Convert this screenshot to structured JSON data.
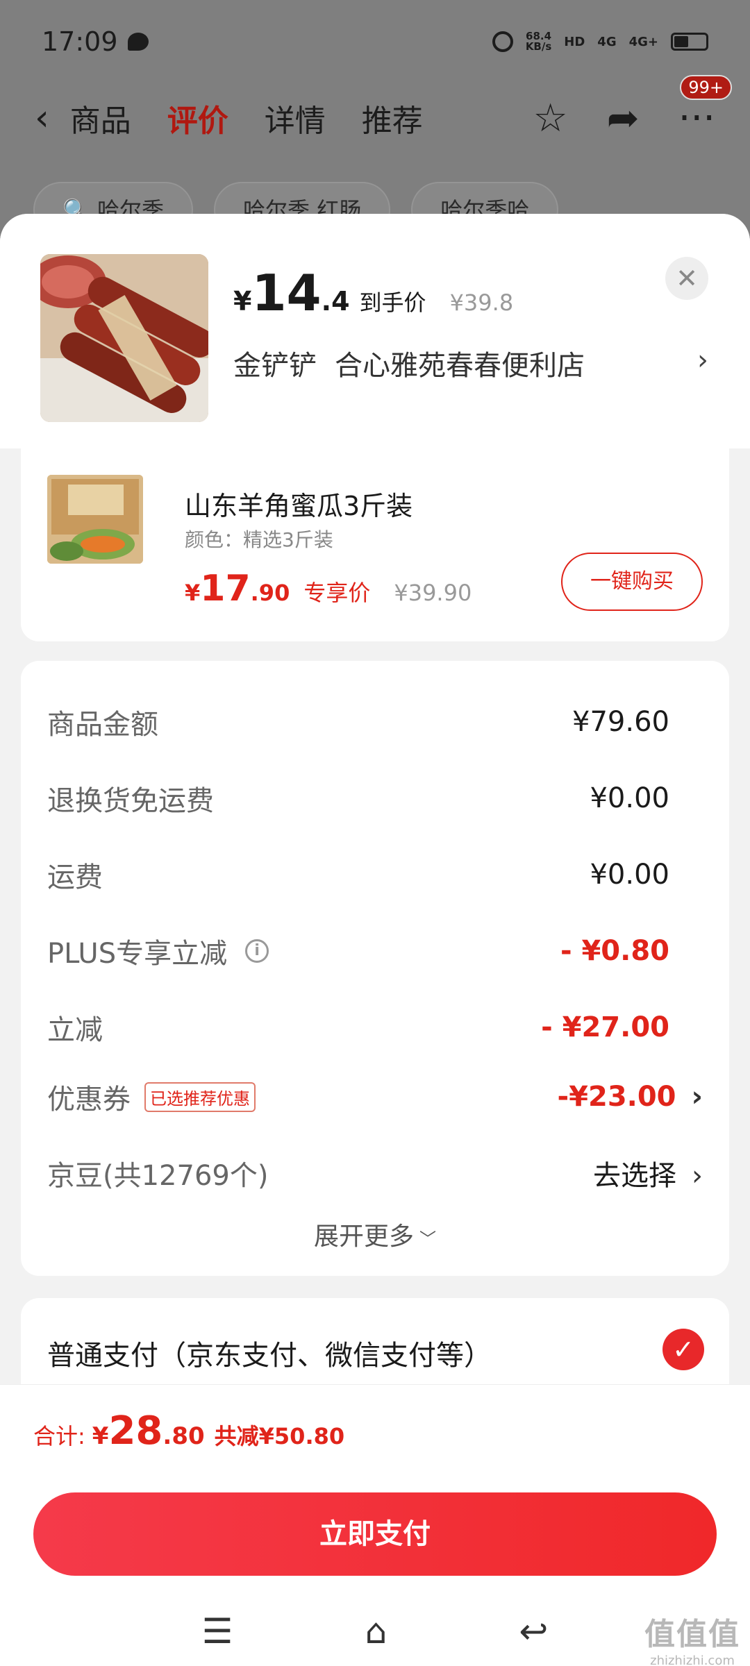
{
  "status_bar": {
    "time": "17:09",
    "net_speed": "68.4",
    "net_unit": "KB/s",
    "hd": "HD",
    "sig1": "4G",
    "sig2": "4G+"
  },
  "nav": {
    "back": "‹",
    "tabs": [
      "商品",
      "评价",
      "详情",
      "推荐"
    ],
    "active_tab": "评价",
    "badge": "99+"
  },
  "background_chips": [
    "哈尔季",
    "哈尔季 红肠",
    "哈尔季哈"
  ],
  "product": {
    "yen": "¥",
    "price_int": "14",
    "price_dec": ".4",
    "price_tag": "到手价",
    "orig_price": "¥39.8",
    "seller_nick": "金铲铲",
    "shop_name": "合心雅苑春春便利店"
  },
  "recommend": {
    "title": "山东羊角蜜瓜3斤装",
    "spec": "颜色：精选3斤装",
    "yen": "¥",
    "price_int": "17",
    "price_dec": ".90",
    "price_tag": "专享价",
    "orig_price": "¥39.90",
    "buy_label": "一键购买"
  },
  "fees": [
    {
      "label": "商品金额",
      "value": "¥79.60"
    },
    {
      "label": "退换货免运费",
      "value": "¥0.00"
    },
    {
      "label": "运费",
      "value": "¥0.00"
    },
    {
      "label": "PLUS专享立减",
      "value": "- ¥0.80"
    },
    {
      "label": "立减",
      "value": "- ¥27.00"
    },
    {
      "label": "优惠券",
      "tag": "已选推荐优惠",
      "value": "-¥23.00"
    },
    {
      "label": "京豆(共12769个)",
      "value": "去选择"
    }
  ],
  "expand_label": "展开更多",
  "payment": {
    "method": "普通支付（京东支付、微信支付等）"
  },
  "total": {
    "label": "合计:",
    "yen": "¥",
    "int": "28",
    "dec": ".80",
    "saving": "共减¥50.80"
  },
  "pay_button": "立即支付",
  "watermark": {
    "logo": "值值值",
    "site": "zhizhizhi.com"
  },
  "colors": {
    "accent": "#e0241a",
    "button": "#f0282a"
  }
}
